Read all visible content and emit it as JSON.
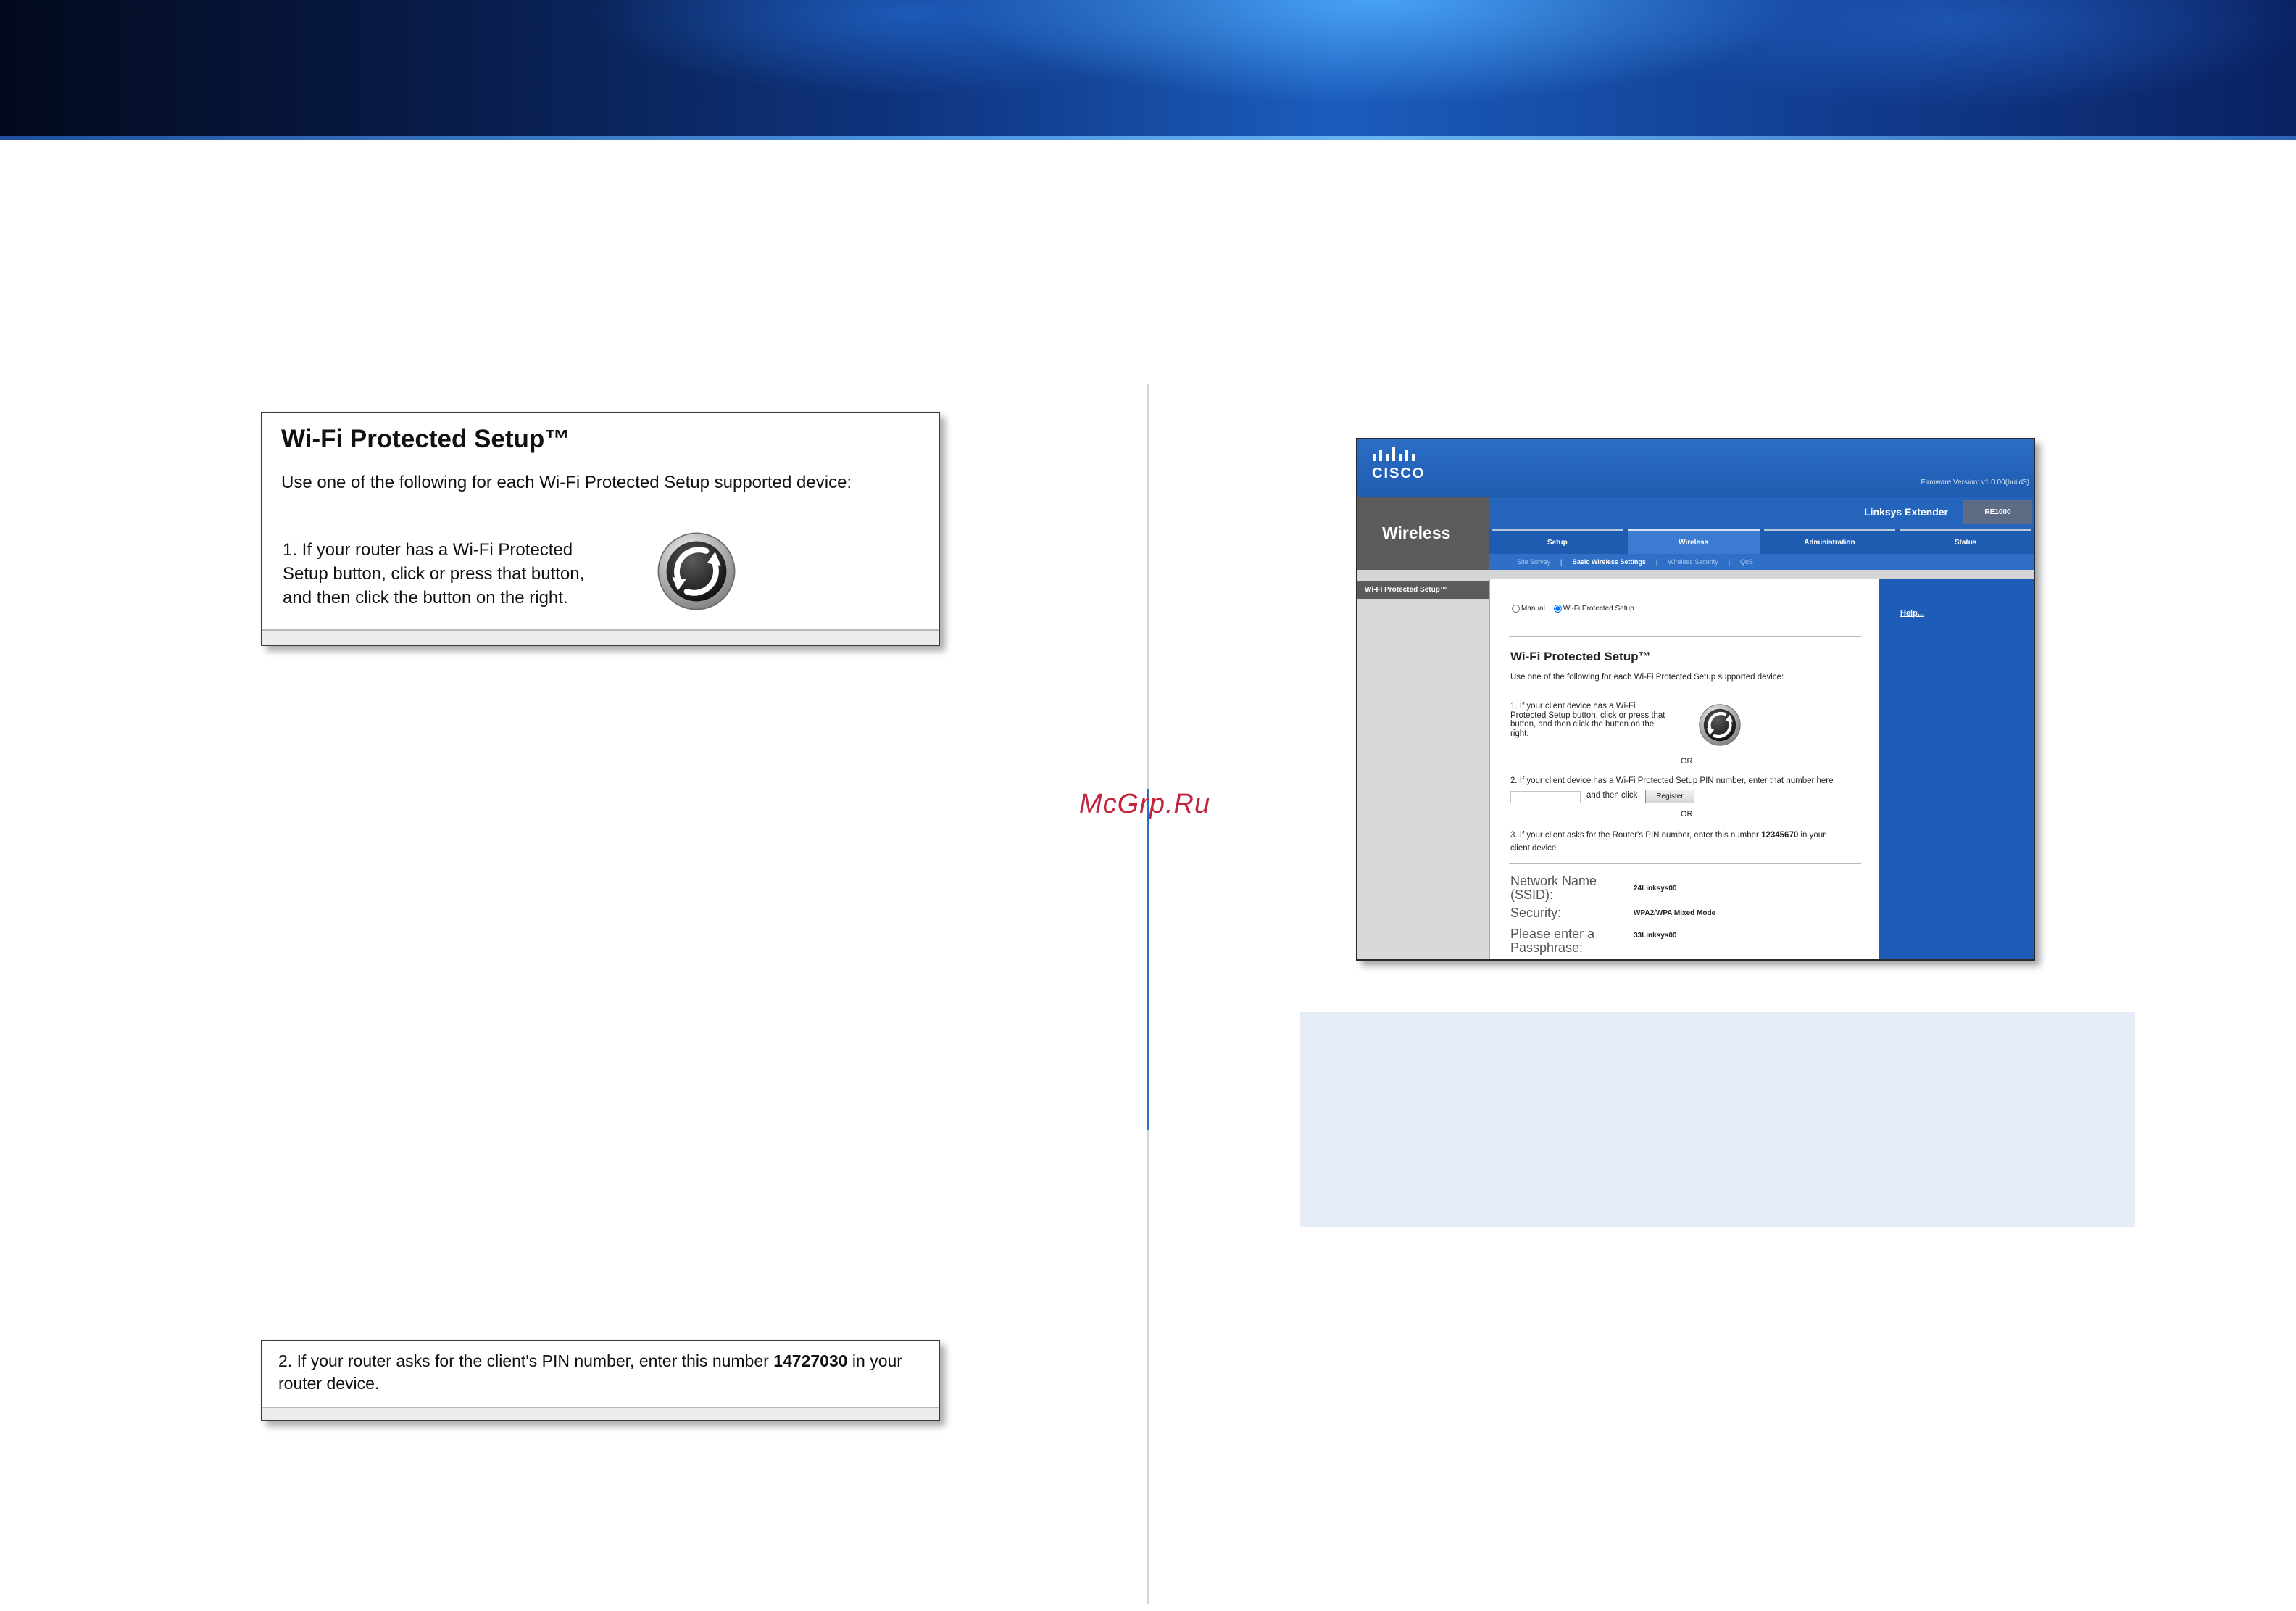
{
  "watermark": "McGrp.Ru",
  "left": {
    "wps_box": {
      "title": "Wi-Fi Protected Setup™",
      "intro": "Use one of the following for each Wi-Fi Protected Setup supported device:",
      "step1_lines": [
        "1. If your router has a Wi-Fi Protected",
        "Setup button, click or press that button,",
        "and then click the button on the right."
      ],
      "button_icon": "wps-icon"
    },
    "pin_box": {
      "line1_prefix": "2. If your router asks for the client's PIN number, enter this number ",
      "pin": "14727030",
      "line1_suffix": " in your",
      "line2": "router device."
    }
  },
  "router_ui": {
    "brand": "CISCO",
    "firmware": "Firmware Version: v1.0.00(build3)",
    "product_name": "Linksys Extender",
    "model": "RE1000",
    "section": "Wireless",
    "tabs": [
      {
        "label": "Setup",
        "active": false
      },
      {
        "label": "Wireless",
        "active": true
      },
      {
        "label": "Administration",
        "active": false
      },
      {
        "label": "Status",
        "active": false
      }
    ],
    "subtabs": [
      {
        "label": "Site Survey",
        "active": false
      },
      {
        "label": "Basic Wireless Settings",
        "active": true
      },
      {
        "label": "Wireless Security",
        "active": false
      },
      {
        "label": "QoS",
        "active": false
      }
    ],
    "subtab_separator": "|",
    "sidebar_item": "Wi-Fi Protected Setup™",
    "radios": [
      {
        "label": "Manual",
        "checked": false
      },
      {
        "label": "Wi-Fi Protected Setup",
        "checked": true
      }
    ],
    "heading": "Wi-Fi Protected Setup™",
    "intro": "Use one of the following for each Wi-Fi Protected Setup supported device:",
    "step1_lines": [
      "1. If your client device has a Wi-Fi",
      "Protected Setup button, click or press that",
      "button, and then click the button on the",
      "right."
    ],
    "or_label": "OR",
    "step2_text": "2. If your client device has a Wi-Fi Protected Setup PIN number, enter that number here",
    "step2_click": "and then click",
    "register_label": "Register",
    "step3_prefix": "3. If your client asks for the Router's PIN number, enter this number ",
    "router_pin": "12345670",
    "step3_suffix": " in your",
    "step3_line2": "client device.",
    "fields": [
      {
        "label": "Network Name (SSID):",
        "value": "24Linksys00"
      },
      {
        "label": "Security:",
        "value": "WPA2/WPA Mixed Mode"
      },
      {
        "label": "Please enter a Passphrase:",
        "value": "33Linksys00"
      }
    ],
    "help_label": "Help..."
  },
  "colors": {
    "banner_dark": "#030a1e",
    "banner_bright": "#4f9ae6",
    "cisco_blue": "#2465bb",
    "panel_gray": "#5b5b5b",
    "help_blue": "#1d5db8",
    "note_bg": "#e6edf8",
    "watermark": "#c0263d",
    "divider_accent": "#2a6fc8"
  }
}
